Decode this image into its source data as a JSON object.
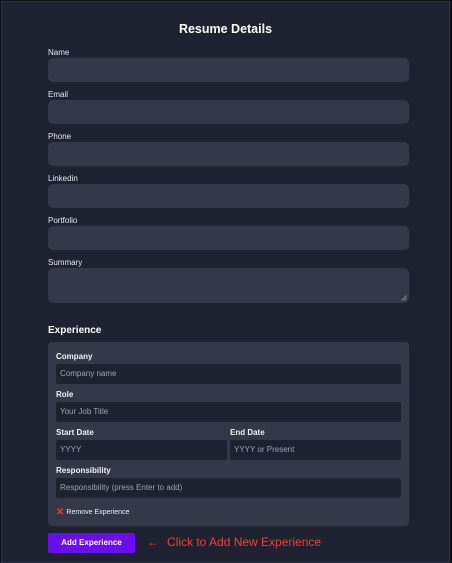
{
  "form": {
    "title": "Resume Details",
    "fields": {
      "name": "Name",
      "email": "Email",
      "phone": "Phone",
      "linkedin": "Linkedin",
      "portfolio": "Portfolio",
      "summary": "Summary"
    }
  },
  "experience": {
    "section_title": "Experience",
    "company_label": "Company",
    "company_placeholder": "Company name",
    "role_label": "Role",
    "role_placeholder": "Your Job Title",
    "start_label": "Start Date",
    "start_placeholder": "YYYY",
    "end_label": "End Date",
    "end_placeholder": "YYYY or Present",
    "responsibility_label": "Responsibility",
    "responsibility_placeholder": "Responsibility (press Enter to add)",
    "remove_label": "Remove Experience"
  },
  "actions": {
    "add_label": "Add Experience",
    "hint": "Click to Add New Experience",
    "hint_arrow": "←"
  },
  "colors": {
    "accent": "#6b0df2",
    "hint": "#e8443a",
    "panel": "#1f2230",
    "input": "#343848"
  }
}
